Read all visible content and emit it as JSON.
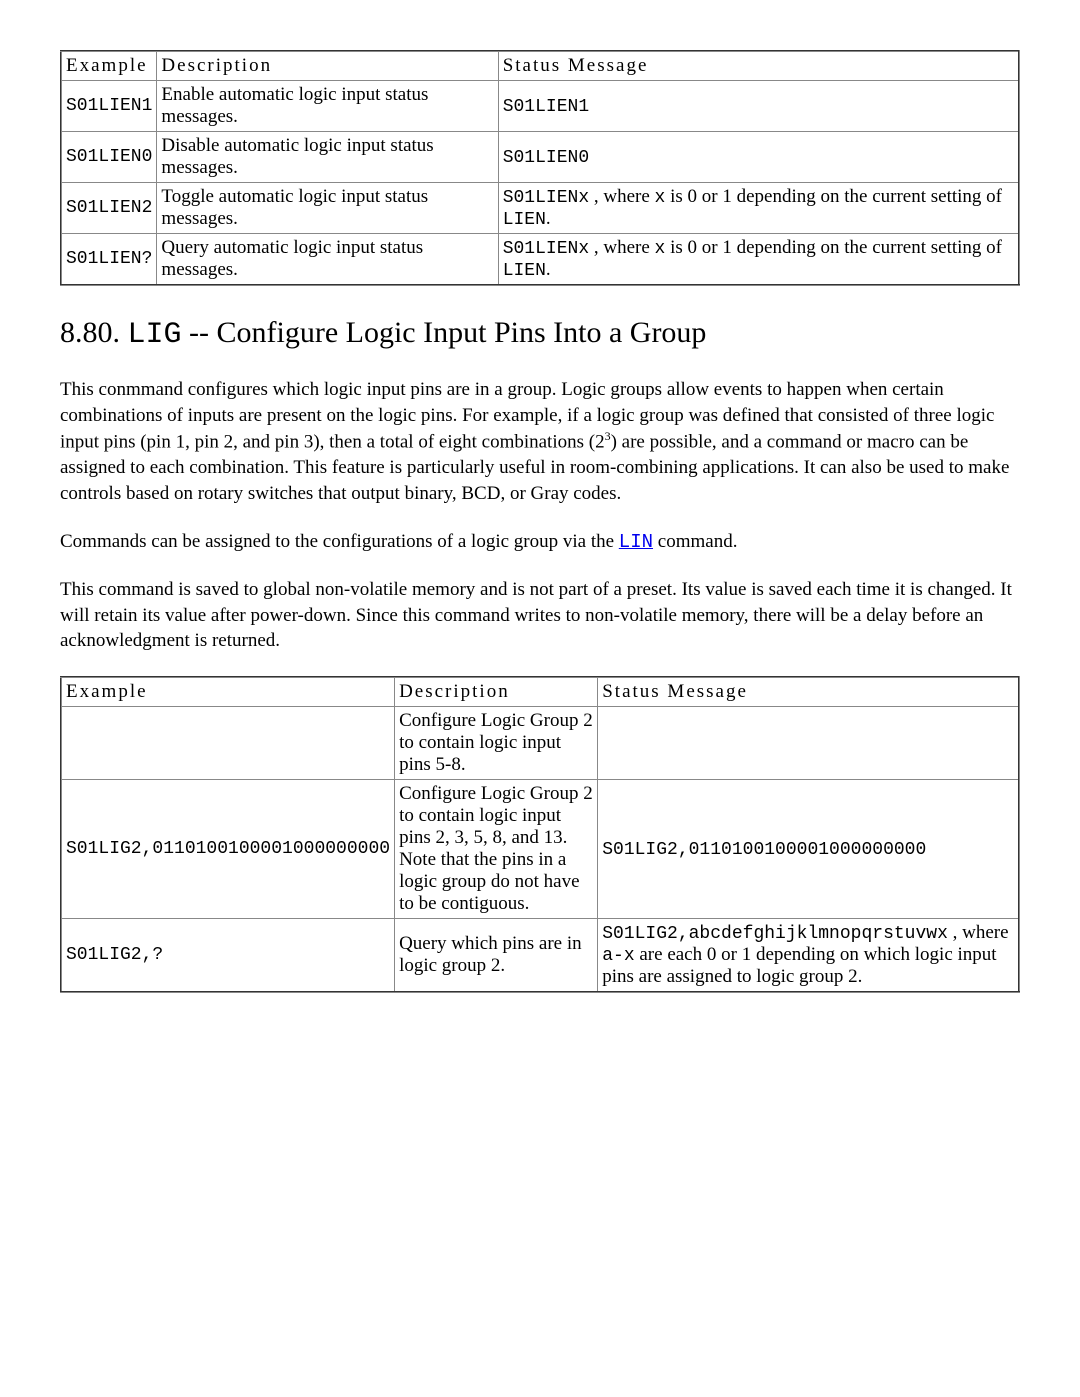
{
  "table1": {
    "headers": {
      "c1": "Example",
      "c2": "Description",
      "c3": "Status Message"
    },
    "rows": [
      {
        "example": "S01LIEN1",
        "desc": "Enable automatic logic input status messages.",
        "status_code": "S01LIEN1",
        "status_text": ""
      },
      {
        "example": "S01LIEN0",
        "desc": "Disable automatic logic input status messages.",
        "status_code": "S01LIEN0",
        "status_text": ""
      },
      {
        "example": "S01LIEN2",
        "desc": "Toggle automatic logic input status messages.",
        "status_code": "S01LIENx",
        "status_text_pre": " , where ",
        "status_text_mid_code": "x",
        "status_text_mid": " is 0 or 1 depending on the current setting of ",
        "status_text_end_code": "LIEN",
        "status_text_end": "."
      },
      {
        "example": "S01LIEN?",
        "desc": "Query automatic logic input status messages.",
        "status_code": "S01LIENx",
        "status_text_pre": " , where ",
        "status_text_mid_code": "x",
        "status_text_mid": " is 0 or 1 depending on the current setting of ",
        "status_text_end_code": "LIEN",
        "status_text_end": "."
      }
    ]
  },
  "heading": {
    "num": "8.80. ",
    "code": "LIG",
    "title": " -- Configure Logic Input Pins Into a Group"
  },
  "para1": {
    "pre": "This conmmand configures which logic input pins are in a group. Logic groups allow events to happen when certain combinations of inputs are present on the logic pins. For example, if a logic group was defined that consisted of three logic input pins (pin 1, pin 2, and pin 3), then a total of eight combinations (2",
    "sup": "3",
    "post": ") are possible, and a command or macro can be assigned to each combination. This feature is particularly useful in room-combining applications. It can also be used to make controls based on rotary switches that output binary, BCD, or Gray codes."
  },
  "para2": {
    "pre": "Commands can be assigned to the configurations of a logic group via the ",
    "link": "LIN",
    "post": " command."
  },
  "para3": "This command is saved to global non-volatile memory and is not part of a preset. Its value is saved each time it is changed. It will retain its value after power-down. Since this command writes to non-volatile memory, there will be a delay before an acknowledgment is returned.",
  "table2": {
    "headers": {
      "c1": "Example",
      "c2": "Description",
      "c3": "Status Message"
    },
    "rows": [
      {
        "example": "",
        "desc": "Configure Logic Group 2 to contain logic input pins 5-8.",
        "status": ""
      },
      {
        "example": "S01LIG2,0110100100001000000000",
        "desc": "Configure Logic Group 2 to contain logic input pins 2, 3, 5, 8, and 13. Note that the pins in a logic group do not have to be contiguous.",
        "status_code": "S01LIG2,0110100100001000000000",
        "status_text": ""
      },
      {
        "example": "S01LIG2,?",
        "desc": "Query which pins are in logic group 2.",
        "status_code": "S01LIG2,abcdefghijklmnopqrstuvwx",
        "status_text_pre": " , where ",
        "status_text_mid_code": "a-x",
        "status_text_mid": " are each 0 or 1 depending on which logic input pins are assigned to logic group 2."
      }
    ]
  }
}
